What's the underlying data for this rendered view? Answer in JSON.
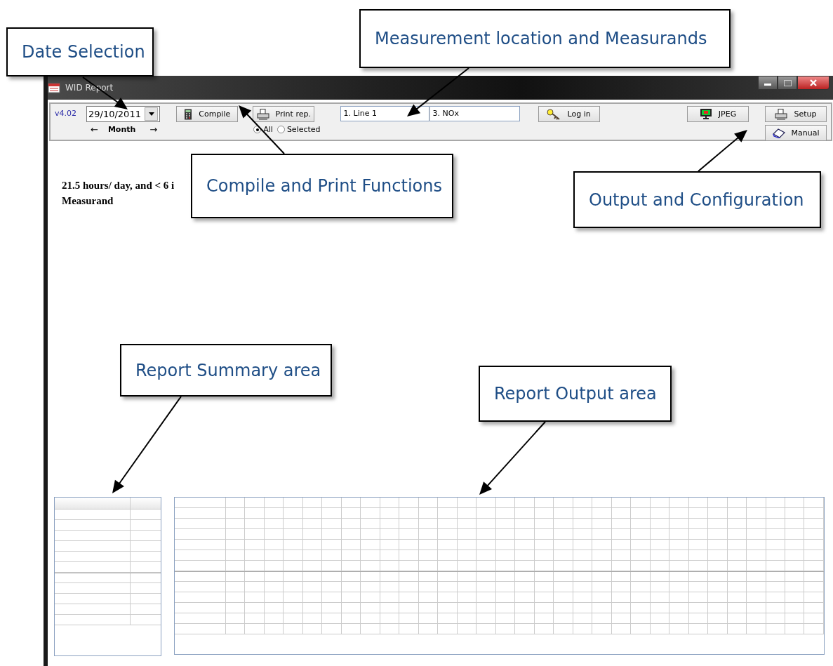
{
  "window": {
    "title": "WID Report"
  },
  "toolbar": {
    "version": "v4.02",
    "date": "29/10/2011",
    "period_nav": {
      "prev": "←",
      "label": "Month",
      "next": "→"
    },
    "buttons": [
      {
        "kind": "compile",
        "label": "Compile"
      },
      {
        "kind": "print",
        "label": "Print rep."
      },
      {
        "kind": "login",
        "label": "Log in"
      },
      {
        "kind": "jpeg",
        "label": "JPEG"
      },
      {
        "kind": "setup",
        "label": "Setup"
      },
      {
        "kind": "manual",
        "label": "Manual"
      }
    ],
    "fields": [
      {
        "value": "1. Line 1"
      },
      {
        "value": "3. NOx"
      }
    ],
    "print_scope": [
      {
        "label": "All",
        "selected": true
      },
      {
        "label": "Selected",
        "selected": false
      }
    ]
  },
  "report_text": [
    "21.5 hours/ day, and < 6 i",
    "Measurand"
  ],
  "callouts": [
    {
      "text": "Date Selection"
    },
    {
      "text": "Measurement location and Measurands"
    },
    {
      "text": "Compile and Print Functions"
    },
    {
      "text": "Output and Configuration"
    },
    {
      "text": "Report Summary area"
    },
    {
      "text": "Report Output area"
    }
  ]
}
